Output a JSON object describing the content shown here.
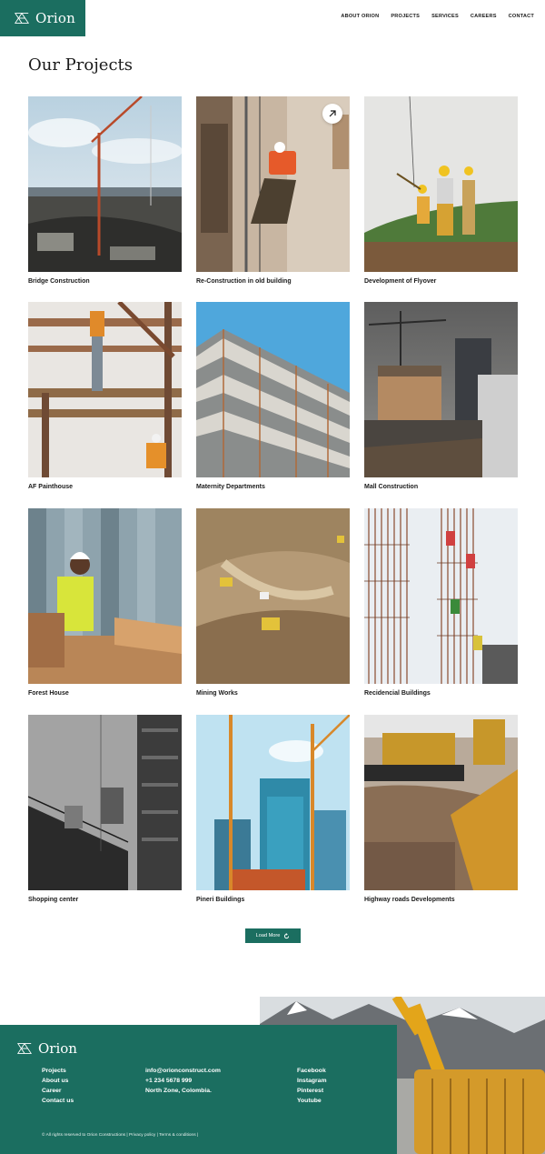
{
  "header": {
    "brand": "Orion",
    "nav": [
      "ABOUT ORION",
      "PROJECTS",
      "SERVICES",
      "CAREERS",
      "CONTACT"
    ]
  },
  "page": {
    "title": "Our Projects"
  },
  "projects": [
    "Bridge Construction",
    "Re-Construction in old building",
    "Development of Flyover",
    "AF Painthouse",
    "Maternity Departments",
    "Mall Construction",
    "Forest House",
    "Mining Works",
    "Recidencial Buildings",
    "Shopping center",
    "Pineri Buildings",
    "Highway roads Developments"
  ],
  "load_more": {
    "label": "Load More"
  },
  "footer": {
    "brand": "Orion",
    "links": [
      "Projects",
      "About us",
      "Career",
      "Contact us"
    ],
    "contact": {
      "email": "info@orionconstruct.com",
      "phone": "+1 234 5678 999",
      "address": "North Zone, Colombia."
    },
    "social": [
      "Facebook",
      "Instagram",
      "Pinterest",
      "Youtube"
    ],
    "copyright": "© All rights reserved to Orion Constructions | Privacy policy | Terms & conditions |"
  },
  "colors": {
    "brand": "#1b6e60",
    "text": "#1a1a1a",
    "background": "#ffffff"
  }
}
